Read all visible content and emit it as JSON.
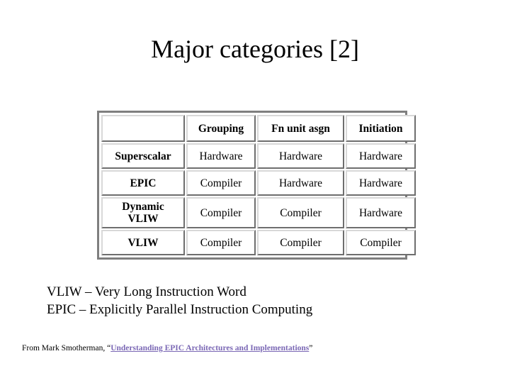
{
  "slide": {
    "title": "Major categories [2]",
    "background_color": "#ffffff"
  },
  "table": {
    "columns": [
      "",
      "Grouping",
      "Fn unit asgn",
      "Initiation"
    ],
    "rows": [
      {
        "label": "Superscalar",
        "cells": [
          {
            "text": "Hardware",
            "shaded": false
          },
          {
            "text": "Hardware",
            "shaded": false
          },
          {
            "text": "Hardware",
            "shaded": false
          }
        ]
      },
      {
        "label": "EPIC",
        "cells": [
          {
            "text": "Compiler",
            "shaded": true
          },
          {
            "text": "Hardware",
            "shaded": false
          },
          {
            "text": "Hardware",
            "shaded": false
          }
        ]
      },
      {
        "label": "Dynamic VLIW",
        "label_line1": "Dynamic",
        "label_line2": "VLIW",
        "cells": [
          {
            "text": "Compiler",
            "shaded": true
          },
          {
            "text": "Compiler",
            "shaded": true
          },
          {
            "text": "Hardware",
            "shaded": false
          }
        ]
      },
      {
        "label": "VLIW",
        "cells": [
          {
            "text": "Compiler",
            "shaded": true
          },
          {
            "text": "Compiler",
            "shaded": true
          },
          {
            "text": "Compiler",
            "shaded": true
          }
        ]
      }
    ],
    "shaded_cell_color": "#e2e2e2",
    "plain_cell_color": "#ffffff",
    "border_color": "#7f7f7f"
  },
  "definitions": [
    "VLIW – Very Long Instruction Word",
    "EPIC – Explicitly Parallel Instruction Computing"
  ],
  "citation": {
    "prefix": "From Mark Smotherman, “",
    "link_text": "Understanding EPIC Architectures and Implementations",
    "suffix": "”",
    "link_color": "#7b68b5"
  }
}
